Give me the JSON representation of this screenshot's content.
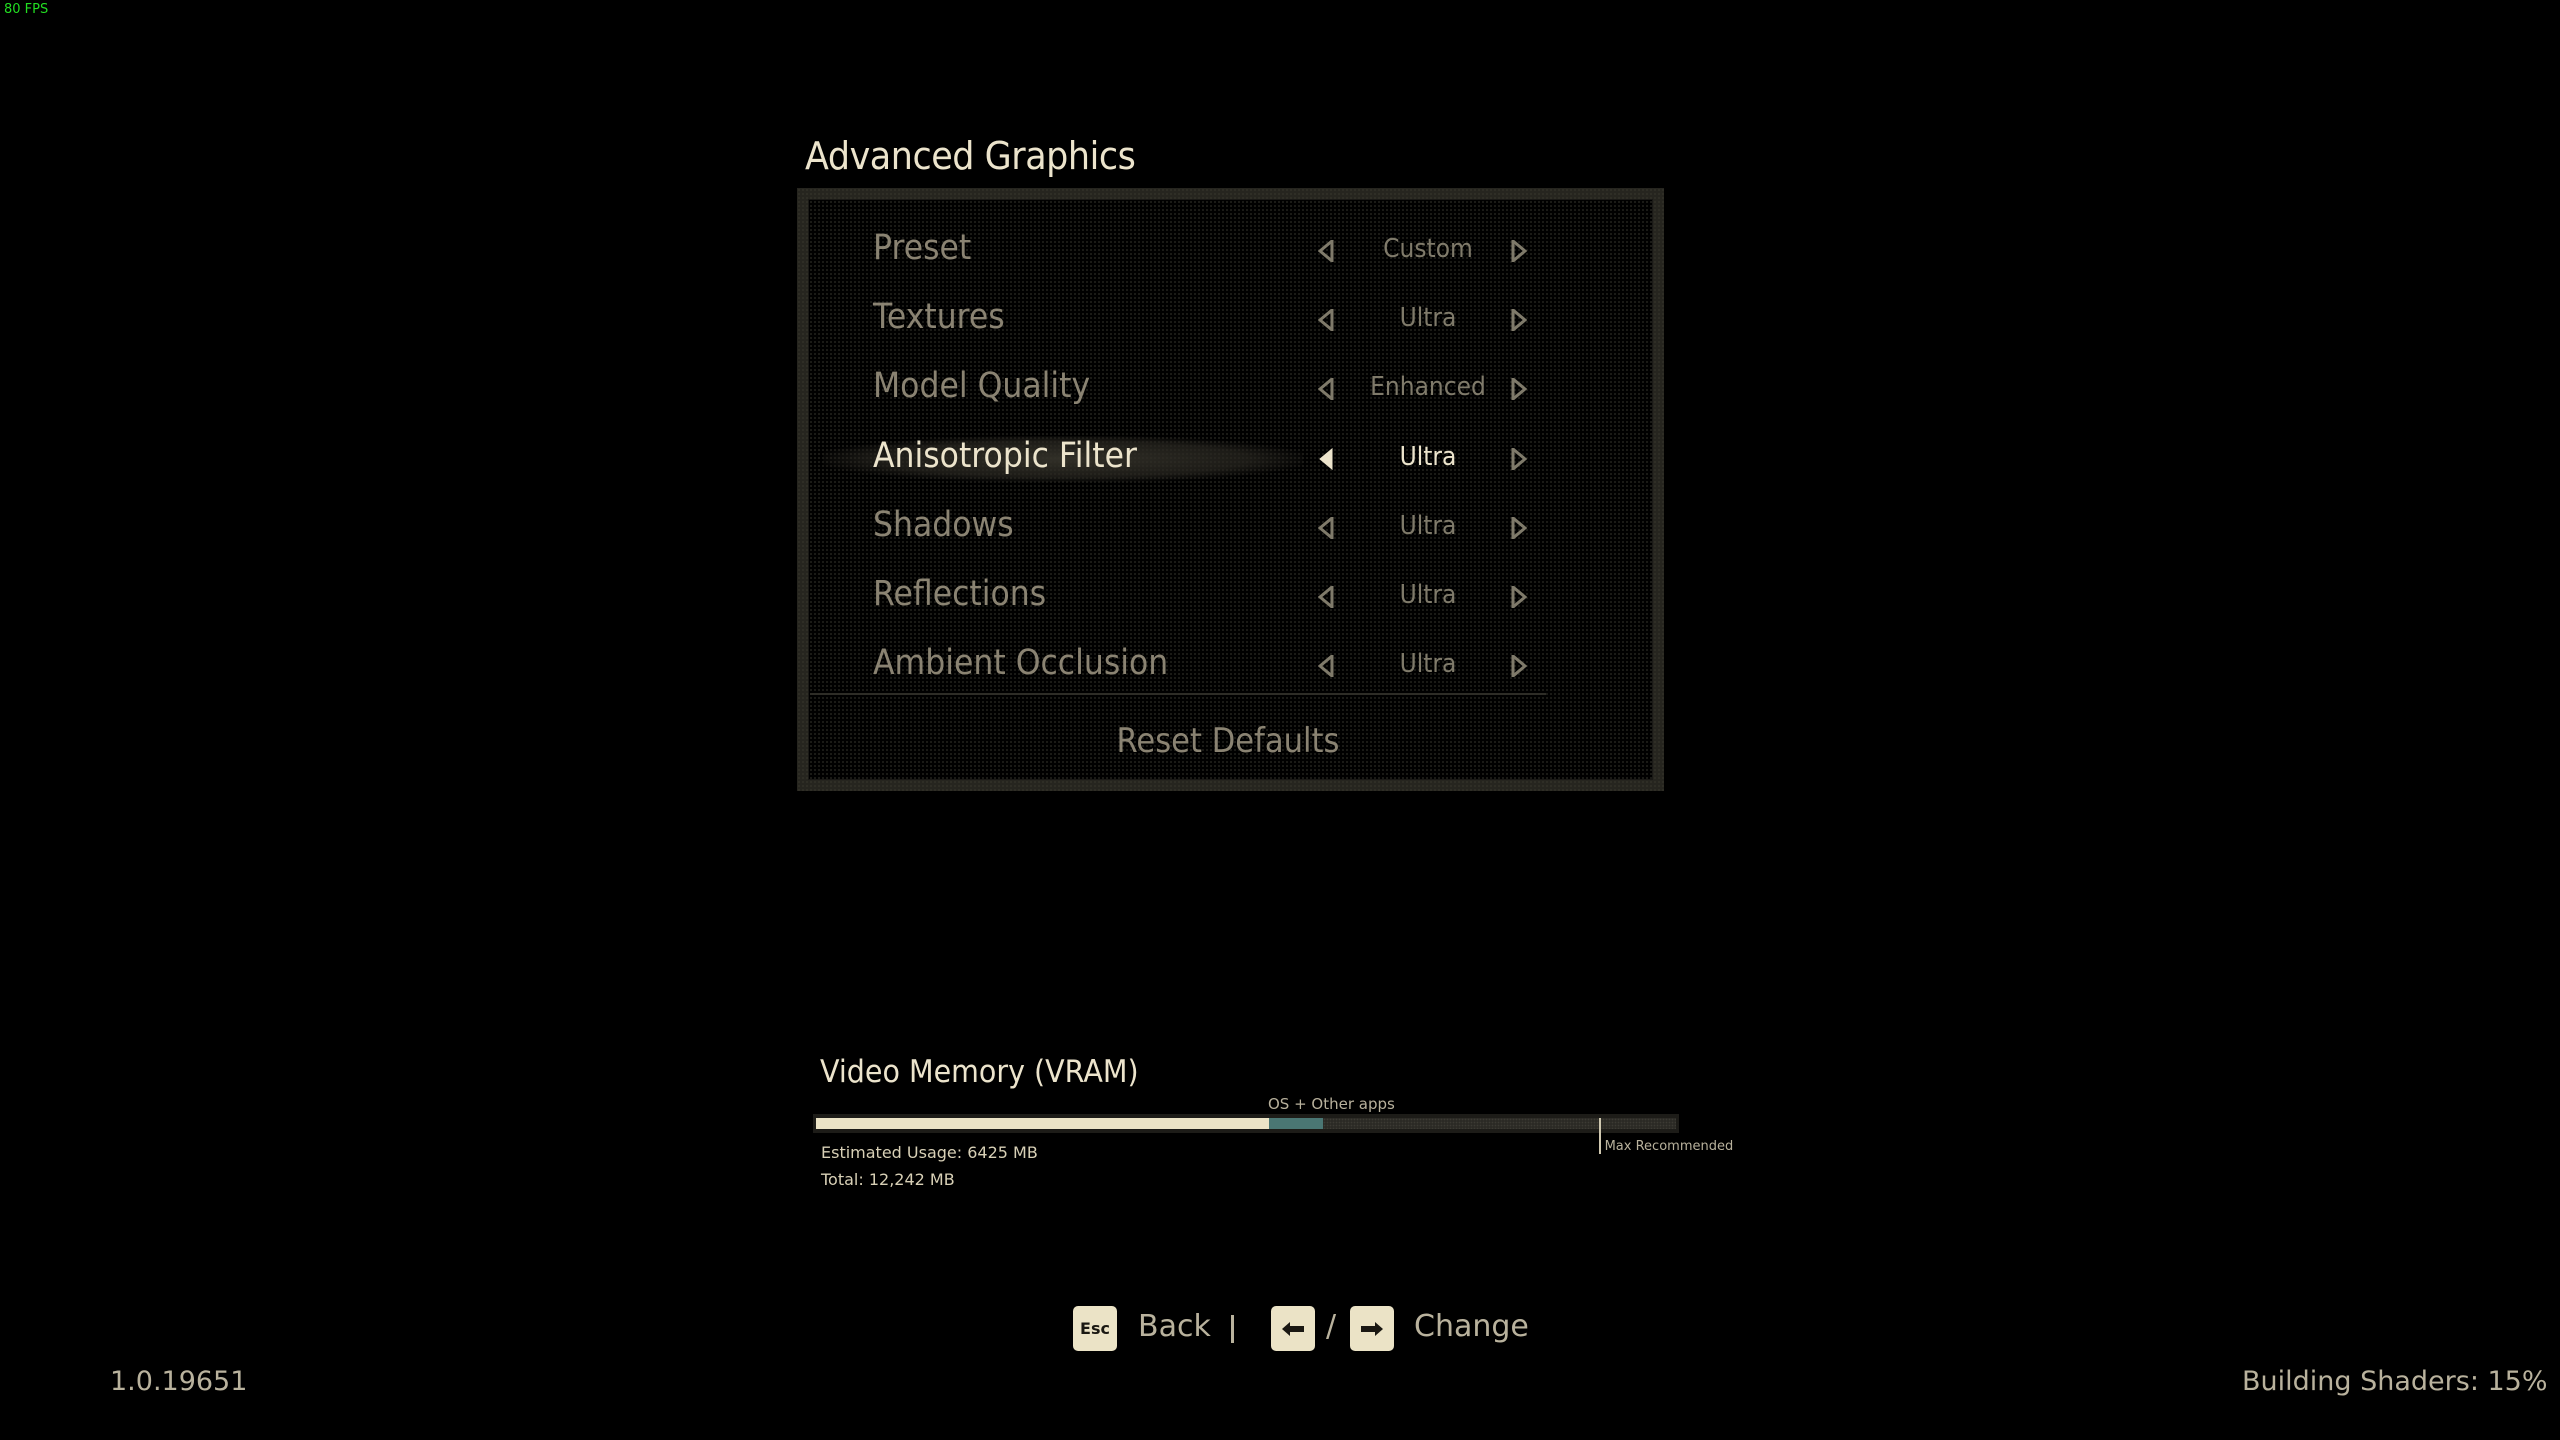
{
  "overlay": {
    "fps": "80 FPS"
  },
  "page": {
    "title": "Advanced Graphics"
  },
  "settings": [
    {
      "label": "Preset",
      "value": "Custom",
      "selected": false
    },
    {
      "label": "Textures",
      "value": "Ultra",
      "selected": false
    },
    {
      "label": "Model Quality",
      "value": "Enhanced",
      "selected": false
    },
    {
      "label": "Anisotropic Filter",
      "value": "Ultra",
      "selected": true
    },
    {
      "label": "Shadows",
      "value": "Ultra",
      "selected": false
    },
    {
      "label": "Reflections",
      "value": "Ultra",
      "selected": false
    },
    {
      "label": "Ambient Occlusion",
      "value": "Ultra",
      "selected": false
    }
  ],
  "reset": {
    "label": "Reset Defaults"
  },
  "vram": {
    "title": "Video Memory (VRAM)",
    "os_label": "OS + Other apps",
    "max_label": "Max Recommended",
    "estimated_usage_text": "Estimated Usage: 6425 MB",
    "total_text": "Total: 12,242 MB",
    "estimated_usage_mb": 6425,
    "total_mb": 12242,
    "usage_fraction": 0.527,
    "os_fraction": 0.063,
    "max_recommended_fraction": 0.91
  },
  "hints": {
    "back_key": "Esc",
    "back_label": "Back",
    "separator": "|",
    "left_key_icon": "arrow-left",
    "slash": "/",
    "right_key_icon": "arrow-right",
    "change_label": "Change"
  },
  "footer": {
    "version": "1.0.19651",
    "status": "Building Shaders: 15%",
    "shader_progress_percent": 15
  },
  "colors": {
    "accent_cream": "#ece4cc",
    "dim_text": "#8a8372",
    "os_bar": "#4a7673",
    "fps_green": "#22dd22"
  }
}
